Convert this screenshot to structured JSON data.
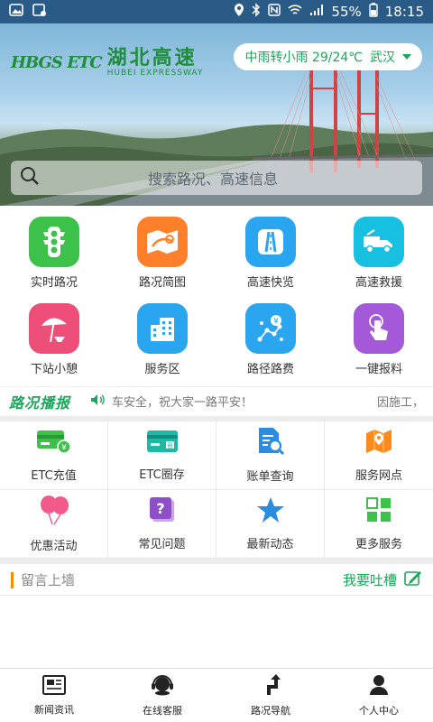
{
  "status_bar": {
    "battery": "55%",
    "time": "18:15"
  },
  "header": {
    "logo_mark": "HBGS ETC",
    "logo_cn": "湖北高速",
    "logo_en": "HUBEI EXPRESSWAY",
    "weather": "中雨转小雨 29/24℃",
    "city": "武汉"
  },
  "search": {
    "placeholder": "搜索路况、高速信息"
  },
  "main_grid": [
    {
      "label": "实时路况",
      "icon": "traffic-light-icon",
      "color": "#3cc24a"
    },
    {
      "label": "路况简图",
      "icon": "road-map-icon",
      "color": "#ff7f2a"
    },
    {
      "label": "高速快览",
      "icon": "highway-icon",
      "color": "#2aa6f0"
    },
    {
      "label": "高速救援",
      "icon": "tow-truck-icon",
      "color": "#17bfe0"
    },
    {
      "label": "下站小憩",
      "icon": "beach-umbrella-icon",
      "color": "#ee4f78"
    },
    {
      "label": "服务区",
      "icon": "building-icon",
      "color": "#2aa6f0"
    },
    {
      "label": "路径路费",
      "icon": "route-fee-icon",
      "color": "#2aa6f0"
    },
    {
      "label": "一键报料",
      "icon": "tap-hand-icon",
      "color": "#a359d8"
    }
  ],
  "ticker": {
    "title": "路况播报",
    "message": "车安全，祝大家一路平安！",
    "tail": "因施工，"
  },
  "services": [
    {
      "label": "ETC充值",
      "icon": "etc-card-recharge-icon"
    },
    {
      "label": "ETC圈存",
      "icon": "etc-card-load-icon"
    },
    {
      "label": "账单查询",
      "icon": "bill-search-icon"
    },
    {
      "label": "服务网点",
      "icon": "map-location-icon"
    },
    {
      "label": "优惠活动",
      "icon": "balloons-icon"
    },
    {
      "label": "常见问题",
      "icon": "question-icon"
    },
    {
      "label": "最新动态",
      "icon": "star-icon"
    },
    {
      "label": "更多服务",
      "icon": "more-grid-icon"
    }
  ],
  "wall": {
    "title": "留言上墙",
    "action": "我要吐槽"
  },
  "bottom_nav": [
    {
      "label": "新闻资讯",
      "icon": "newspaper-icon"
    },
    {
      "label": "在线客服",
      "icon": "customer-service-icon"
    },
    {
      "label": "路况导航",
      "icon": "navigation-icon"
    },
    {
      "label": "个人中心",
      "icon": "user-icon"
    }
  ]
}
